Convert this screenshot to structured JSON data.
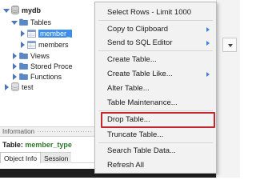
{
  "navigator": {
    "schema_name": "mydb",
    "tables_label": "Tables",
    "selected_table": "member_",
    "second_table": "members",
    "views_label": "Views",
    "stored_procedures_label": "Stored Proce",
    "functions_label": "Functions",
    "other_schema": "test"
  },
  "info_panel": {
    "header": "Information",
    "table_prefix": "Table: ",
    "table_name": "member_type",
    "tabs": [
      "Object Info",
      "Session"
    ]
  },
  "context_menu": {
    "items": [
      "Select Rows - Limit 1000",
      "Copy to Clipboard",
      "Send to SQL Editor",
      "Create Table...",
      "Create Table Like...",
      "Alter Table...",
      "Table Maintenance...",
      "Drop Table...",
      "Truncate Table...",
      "Search Table Data...",
      "Refresh All"
    ],
    "highlighted_item": "Drop Table...",
    "highlight_color": "#c0282d"
  },
  "colors": {
    "selection": "#3d8ee6",
    "tree_arrow": "#4d77b8",
    "submenu_arrow": "#3d7fd9"
  }
}
